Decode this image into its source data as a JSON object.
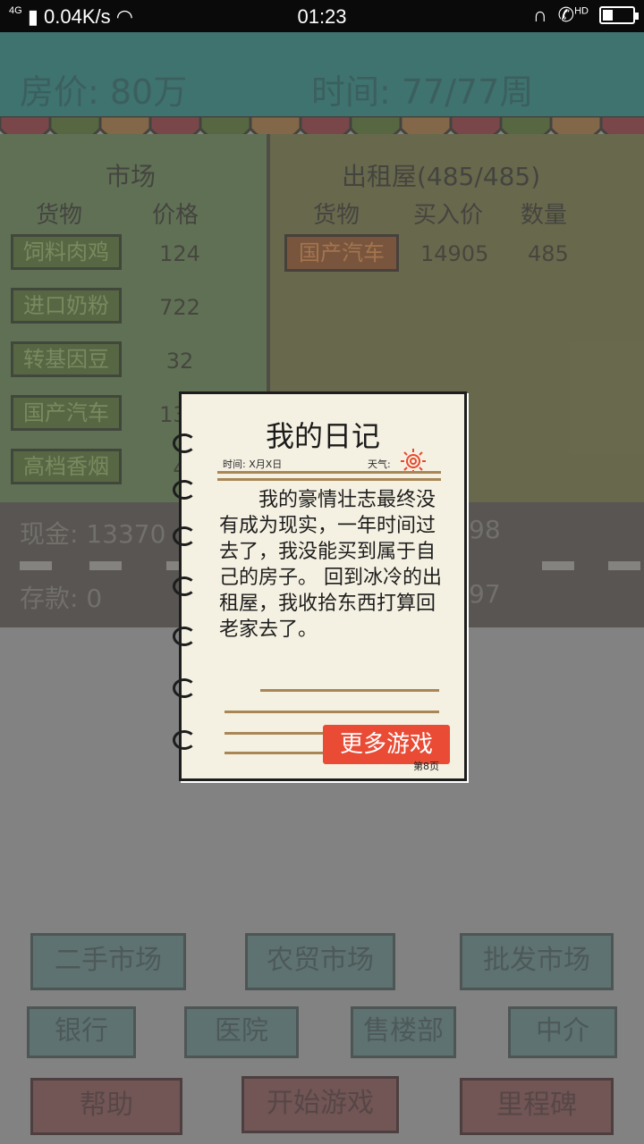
{
  "status_bar": {
    "network": "4G",
    "speed": "0.04K/s",
    "time": "01:23",
    "hd": "HD",
    "battery_level": 0.35
  },
  "header": {
    "price_label": "房价: 80万",
    "time_label": "时间: 77/77周"
  },
  "market": {
    "title": "市场",
    "col_goods": "货物",
    "col_price": "价格",
    "items": [
      {
        "name": "饲料肉鸡",
        "price": "124"
      },
      {
        "name": "进口奶粉",
        "price": "722"
      },
      {
        "name": "转基因豆",
        "price": "32"
      },
      {
        "name": "国产汽车",
        "price": "132"
      },
      {
        "name": "高档香烟",
        "price": "4"
      }
    ]
  },
  "rental": {
    "title": "出租屋(485/485)",
    "col_goods": "货物",
    "col_buy_price": "买入价",
    "col_qty": "数量",
    "items": [
      {
        "name": "国产汽车",
        "buy_price": "14905",
        "qty": "485"
      }
    ]
  },
  "finance": {
    "cash": "现金: 13370",
    "cash_right": "98",
    "deposit": "存款: 0",
    "deposit_right": "97"
  },
  "buttons": {
    "second_hand": "二手市场",
    "farmers": "农贸市场",
    "wholesale": "批发市场",
    "bank": "银行",
    "hospital": "医院",
    "sales_office": "售楼部",
    "agency": "中介",
    "help": "帮助",
    "start_game": "开始游戏",
    "milestone": "里程碑"
  },
  "diary": {
    "title": "我的日记",
    "time_label": "时间: X月X日",
    "weather_label": "天气:",
    "body": "我的豪情壮志最终没有成为现实，一年时间过去了，我没能买到属于自己的房子。 回到冰冷的出租屋，我收拾东西打算回老家去了。",
    "more_games": "更多游戏",
    "page": "第8页"
  },
  "colors": {
    "dim_overlay": "#8a8a8a",
    "more_button": "#e94b35",
    "paper": "#f5f1e2"
  }
}
